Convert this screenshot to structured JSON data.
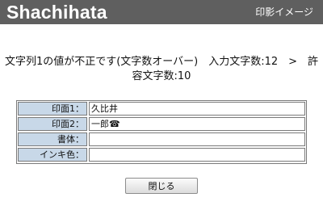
{
  "header": {
    "brand": "Shachihata",
    "title": "印影イメージ"
  },
  "message": {
    "line1": "文字列1の値が不正です(文字数オーバー)　入力文字数:12　>　許",
    "line2": "容文字数:10"
  },
  "form": {
    "rows": [
      {
        "label": "印面1：",
        "value": "久比井"
      },
      {
        "label": "印面2：",
        "value": "一郎☎"
      },
      {
        "label": "書体：",
        "value": ""
      },
      {
        "label": "インキ色：",
        "value": ""
      }
    ]
  },
  "actions": {
    "close_label": "閉じる"
  },
  "colors": {
    "header_bg": "#5f5f5f",
    "label_bg": "#c8d8e8"
  }
}
